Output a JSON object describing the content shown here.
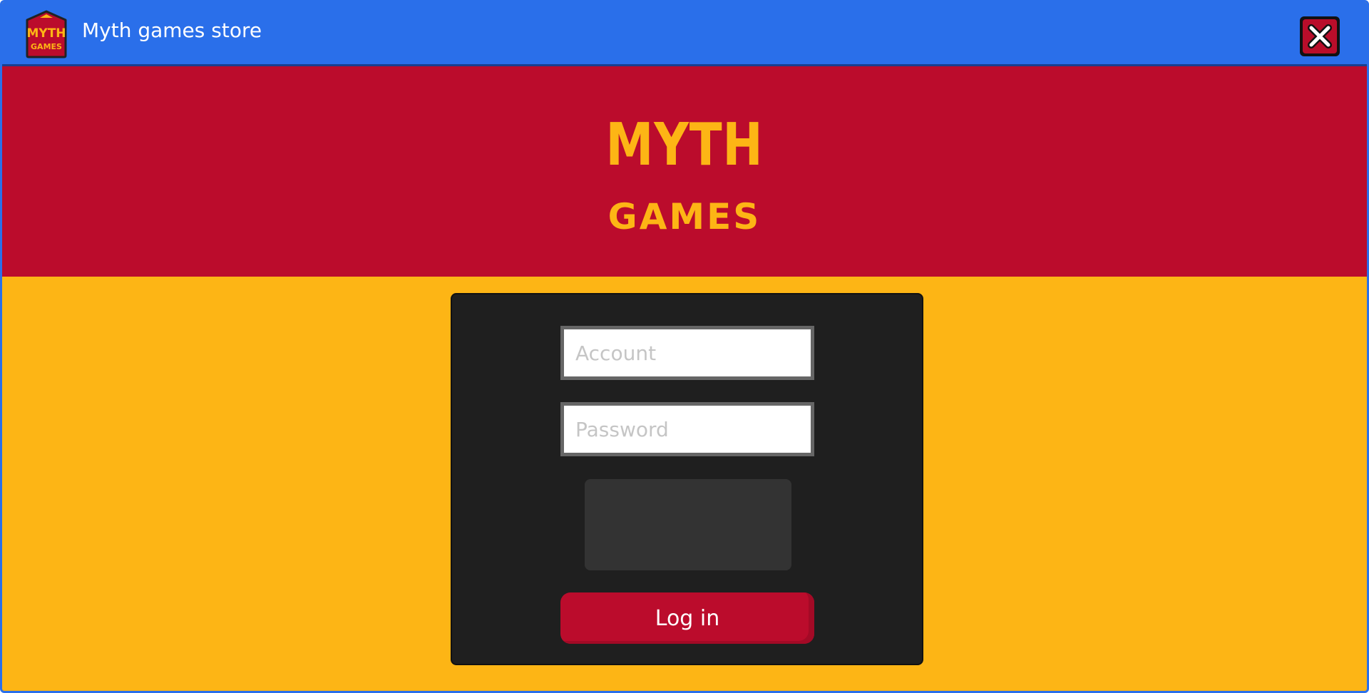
{
  "window": {
    "title": "Myth games store",
    "title_bar_color": "#2a6fea"
  },
  "icons": {
    "app": "myth-games-logo-icon",
    "close": "close-icon"
  },
  "app_icon_text": {
    "line1": "MYTH",
    "line2": "GAMES"
  },
  "banner": {
    "logo_line1": "MYTH",
    "logo_line2": "GAMES",
    "background_color": "#bb0c2c",
    "logo_color": "#fdb515"
  },
  "login": {
    "account_placeholder": "Account",
    "account_value": "",
    "password_placeholder": "Password",
    "password_value": "",
    "button_label": "Log in",
    "button_color": "#bb0c2c"
  },
  "colors": {
    "page_background": "#fdb515",
    "panel_background": "#1f1f1f"
  }
}
